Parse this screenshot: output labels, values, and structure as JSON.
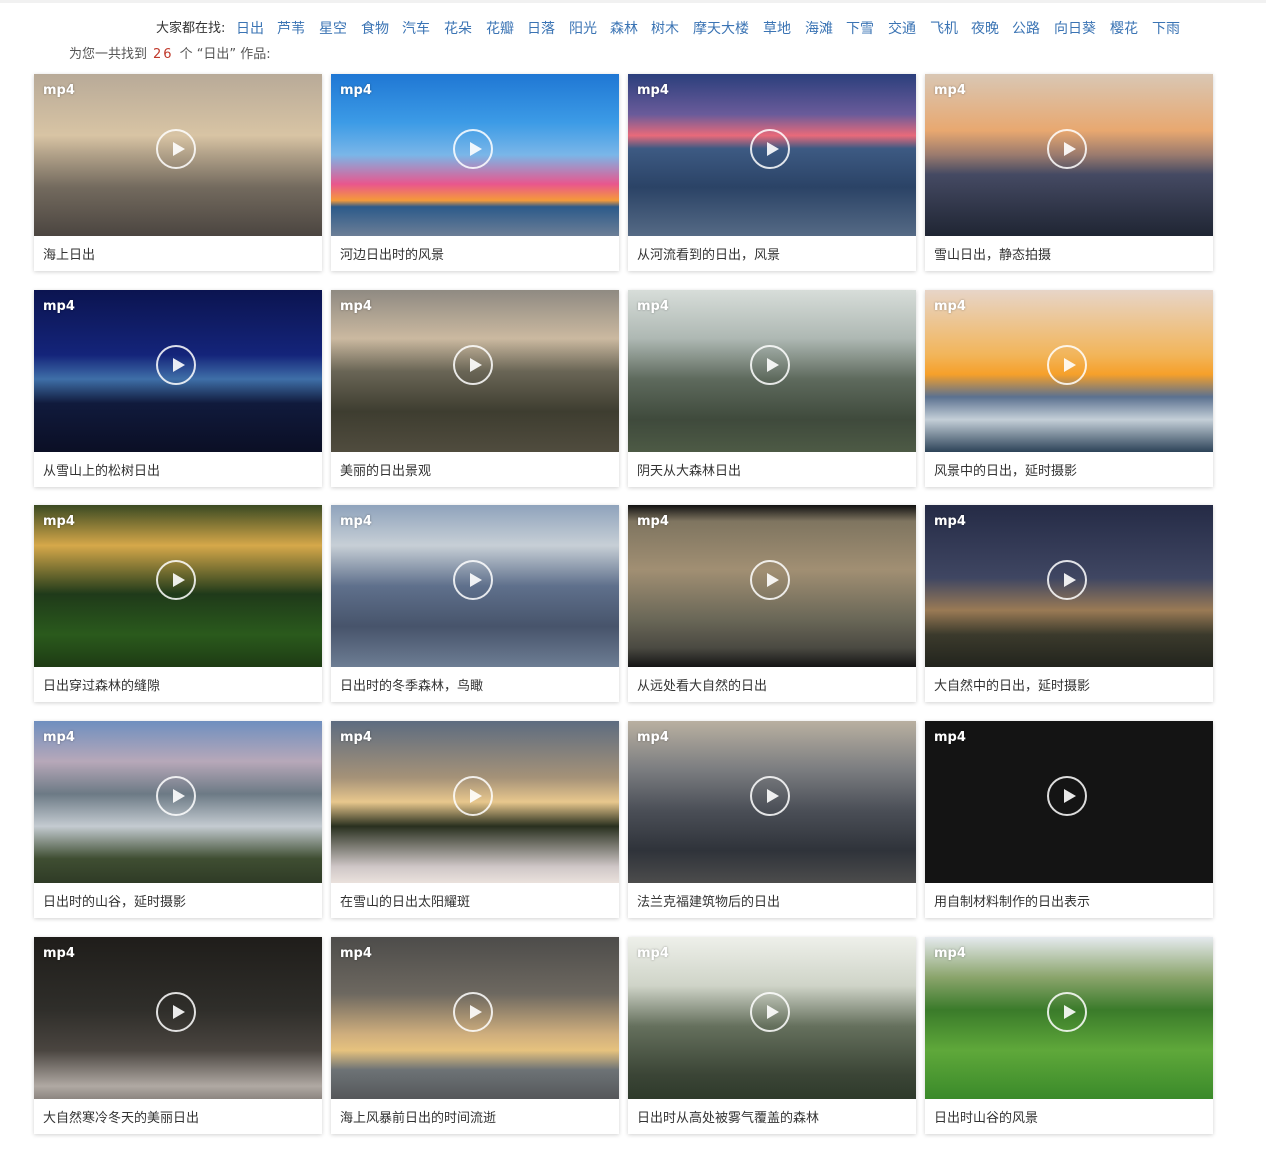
{
  "tags": {
    "label": "大家都在找:",
    "items": [
      "日出",
      "芦苇",
      "星空",
      "食物",
      "汽车",
      "花朵",
      "花瓣",
      "日落",
      "阳光",
      "森林",
      "树木",
      "摩天大楼",
      "草地",
      "海滩",
      "下雪",
      "交通",
      "飞机",
      "夜晚",
      "公路",
      "向日葵",
      "樱花",
      "下雨"
    ]
  },
  "result": {
    "prefix": "为您一共找到",
    "count": "26",
    "suffix": "个 “日出” 作品:"
  },
  "cards": [
    {
      "badge": "mp4",
      "title": "海上日出"
    },
    {
      "badge": "mp4",
      "title": "河边日出时的风景"
    },
    {
      "badge": "mp4",
      "title": "从河流看到的日出，风景"
    },
    {
      "badge": "mp4",
      "title": "雪山日出，静态拍摄"
    },
    {
      "badge": "mp4",
      "title": "从雪山上的松树日出"
    },
    {
      "badge": "mp4",
      "title": "美丽的日出景观"
    },
    {
      "badge": "mp4",
      "title": "阴天从大森林日出"
    },
    {
      "badge": "mp4",
      "title": "风景中的日出，延时摄影"
    },
    {
      "badge": "mp4",
      "title": "日出穿过森林的缝隙"
    },
    {
      "badge": "mp4",
      "title": "日出时的冬季森林，鸟瞰"
    },
    {
      "badge": "mp4",
      "title": "从远处看大自然的日出"
    },
    {
      "badge": "mp4",
      "title": "大自然中的日出，延时摄影"
    },
    {
      "badge": "mp4",
      "title": "日出时的山谷，延时摄影"
    },
    {
      "badge": "mp4",
      "title": "在雪山的日出太阳耀斑"
    },
    {
      "badge": "mp4",
      "title": "法兰克福建筑物后的日出"
    },
    {
      "badge": "mp4",
      "title": "用自制材料制作的日出表示"
    },
    {
      "badge": "mp4",
      "title": "大自然寒冷冬天的美丽日出"
    },
    {
      "badge": "mp4",
      "title": "海上风暴前日出的时间流逝"
    },
    {
      "badge": "mp4",
      "title": "日出时从高处被雾气覆盖的森林"
    },
    {
      "badge": "mp4",
      "title": "日出时山谷的风景"
    }
  ]
}
